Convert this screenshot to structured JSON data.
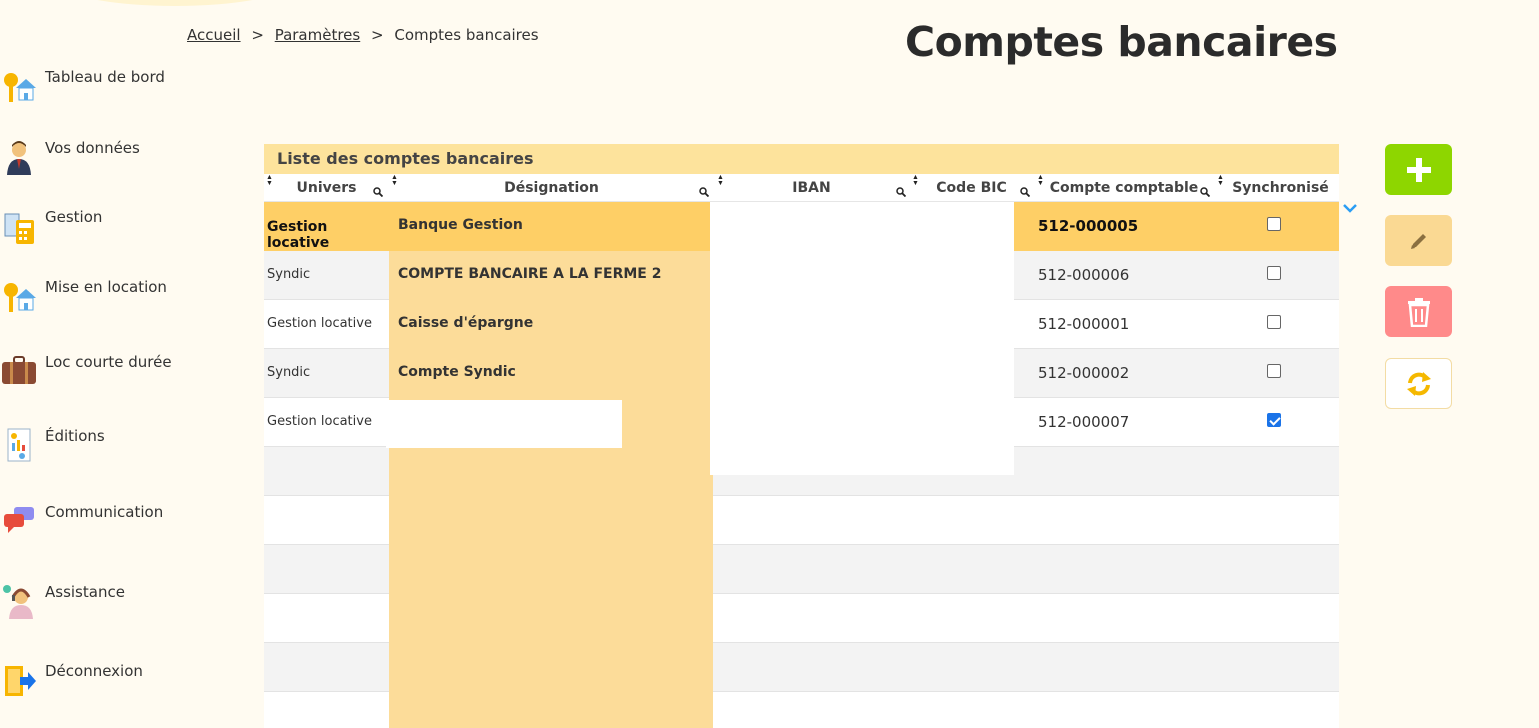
{
  "breadcrumb": {
    "home": "Accueil",
    "settings": "Paramètres",
    "current": "Comptes bancaires",
    "separator": ">"
  },
  "page_title": "Comptes bancaires",
  "sidebar": {
    "items": [
      {
        "label": "Tableau de bord",
        "icon": "keys-house-icon"
      },
      {
        "label": "Vos données",
        "icon": "user-icon"
      },
      {
        "label": "Gestion",
        "icon": "calculator-icon"
      },
      {
        "label": "Mise en location",
        "icon": "keys-house-icon"
      },
      {
        "label": "Loc courte durée",
        "icon": "suitcase-icon"
      },
      {
        "label": "Éditions",
        "icon": "report-icon"
      },
      {
        "label": "Communication",
        "icon": "chat-icon"
      },
      {
        "label": "Assistance",
        "icon": "support-agent-icon"
      },
      {
        "label": "Déconnexion",
        "icon": "logout-icon"
      }
    ]
  },
  "table": {
    "caption": "Liste des comptes bancaires",
    "columns": {
      "univers": "Univers",
      "designation": "Désignation",
      "iban": "IBAN",
      "bic": "Code BIC",
      "compte": "Compte comptable",
      "sync": "Synchronisé"
    },
    "rows": [
      {
        "univers": "Gestion locative",
        "designation": "Banque Gestion",
        "compte": "512-000005",
        "sync": false,
        "selected": true
      },
      {
        "univers": "Syndic",
        "designation": "COMPTE BANCAIRE A LA FERME 2",
        "compte": "512-000006",
        "sync": false
      },
      {
        "univers": "Gestion locative",
        "designation": "Caisse d'épargne",
        "compte": "512-000001",
        "sync": false
      },
      {
        "univers": "Syndic",
        "designation": "Compte Syndic",
        "compte": "512-000002",
        "sync": false
      },
      {
        "univers": "Gestion locative",
        "designation": "",
        "compte": "512-000007",
        "sync": true
      }
    ]
  },
  "actions": {
    "add": "plus-icon",
    "edit": "pencil-icon",
    "delete": "trash-icon",
    "sync": "refresh-icon"
  },
  "colors": {
    "accent": "#fecf66",
    "add": "#8ed600",
    "edit": "#fad993",
    "delete": "#ff8a8a",
    "sync": "#f5b800"
  }
}
